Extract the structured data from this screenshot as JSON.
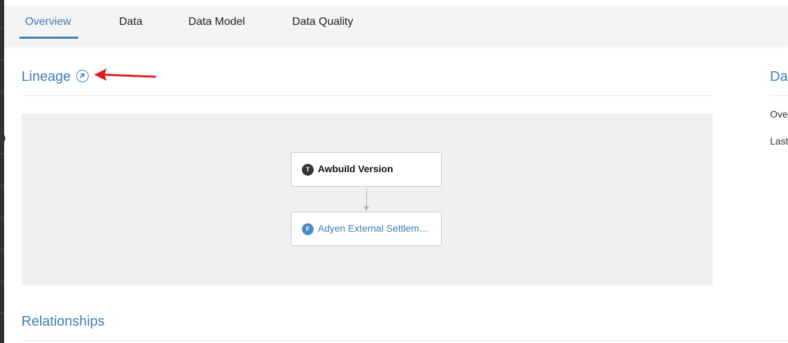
{
  "tabs": [
    {
      "label": "Overview",
      "active": true
    },
    {
      "label": "Data",
      "active": false
    },
    {
      "label": "Data Model",
      "active": false
    },
    {
      "label": "Data Quality",
      "active": false
    }
  ],
  "lineage": {
    "title": "Lineage",
    "icon": "external-link-icon",
    "nodes": [
      {
        "badge": "T",
        "label": "Awbuild Version",
        "badge_color": "#333333"
      },
      {
        "badge": "F",
        "label": "Adyen External Settlem…",
        "badge_color": "#4a8ac4"
      }
    ]
  },
  "relationships": {
    "title": "Relationships"
  },
  "side_panel": {
    "title": "Da",
    "rows": [
      "Ove",
      "Last"
    ]
  },
  "colors": {
    "accent": "#3d7fb4",
    "annotation_arrow": "#e02020",
    "sidebar": "#2e3236"
  }
}
